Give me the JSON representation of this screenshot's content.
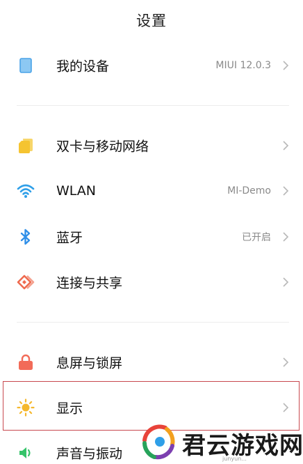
{
  "header": {
    "title": "设置"
  },
  "rows": [
    {
      "id": "device",
      "label": "我的设备",
      "value": "MIUI 12.0.3",
      "icon": "device-icon",
      "color": "#4aa3e8"
    },
    {
      "id": "sim",
      "label": "双卡与移动网络",
      "value": "",
      "icon": "sim-card-icon",
      "color": "#f5c431"
    },
    {
      "id": "wlan",
      "label": "WLAN",
      "value": "MI-Demo",
      "icon": "wifi-icon",
      "color": "#2f9fe8"
    },
    {
      "id": "bluetooth",
      "label": "蓝牙",
      "value": "已开启",
      "icon": "bluetooth-icon",
      "color": "#2f8fe8"
    },
    {
      "id": "share",
      "label": "连接与共享",
      "value": "",
      "icon": "connection-share-icon",
      "color": "#ef6a4f"
    },
    {
      "id": "lock",
      "label": "息屏与锁屏",
      "value": "",
      "icon": "lock-icon",
      "color": "#f26b58"
    },
    {
      "id": "display",
      "label": "显示",
      "value": "",
      "icon": "sun-icon",
      "color": "#f5b82e"
    },
    {
      "id": "sound",
      "label": "声音与振动",
      "value": "",
      "icon": "speaker-icon",
      "color": "#35c46a"
    }
  ],
  "highlight_color": "#c8484e",
  "watermark": {
    "text": "君云游戏网",
    "sub": "junyun..."
  }
}
